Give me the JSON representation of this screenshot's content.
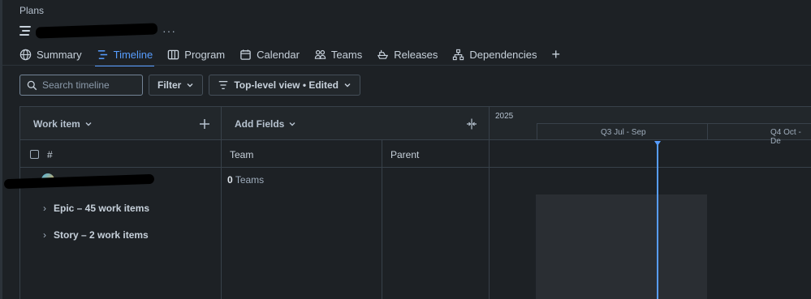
{
  "breadcrumb": "Plans",
  "plan": {
    "more": "···"
  },
  "tabs": [
    {
      "label": "Summary",
      "icon": "globe-icon"
    },
    {
      "label": "Timeline",
      "icon": "timeline-icon",
      "active": true
    },
    {
      "label": "Program",
      "icon": "board-icon"
    },
    {
      "label": "Calendar",
      "icon": "calendar-icon"
    },
    {
      "label": "Teams",
      "icon": "people-icon"
    },
    {
      "label": "Releases",
      "icon": "ship-icon"
    },
    {
      "label": "Dependencies",
      "icon": "hierarchy-icon"
    }
  ],
  "tabs_add": "+",
  "toolbar": {
    "search_placeholder": "Search timeline",
    "filter_label": "Filter",
    "view_label": "Top-level view • Edited"
  },
  "table": {
    "work_item_header": "Work item",
    "add_fields_header": "Add Fields",
    "hash": "#",
    "team_col": "Team",
    "parent_col": "Parent",
    "teams_count": "0",
    "teams_unit": "Teams",
    "groups": [
      {
        "label": "Epic – 45 work items"
      },
      {
        "label": "Story – 2 work items"
      }
    ]
  },
  "timeline": {
    "year": "2025",
    "q3": "Q3 Jul - Sep",
    "q4": "Q4 Oct - De"
  },
  "colors": {
    "accent": "#579dff",
    "background": "#1d2125"
  }
}
